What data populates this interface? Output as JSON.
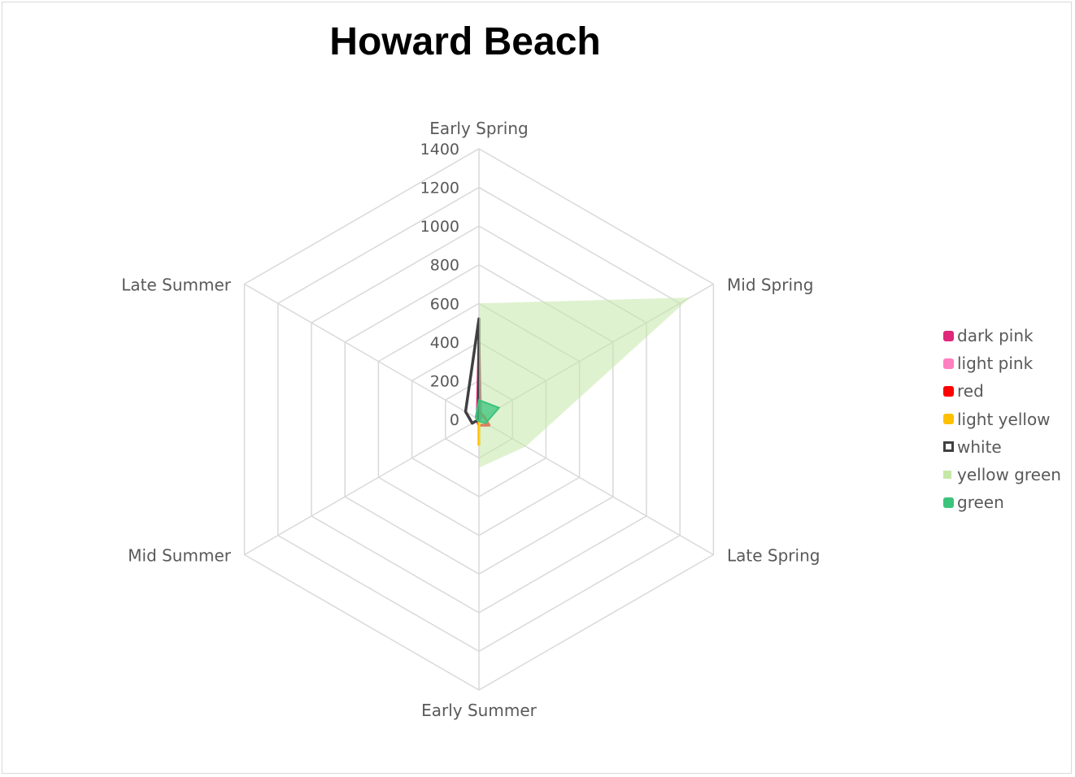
{
  "chart_data": {
    "type": "radar",
    "title": "Howard Beach",
    "axes": [
      "Early Spring",
      "Mid Spring",
      "Late Spring",
      "Early Summer",
      "Mid Summer",
      "Late Summer"
    ],
    "ticks": [
      "0",
      "200",
      "400",
      "600",
      "800",
      "1000",
      "1200",
      "1400"
    ],
    "rlim": [
      0,
      1400
    ],
    "grid": true,
    "legend_position": "right",
    "series": [
      {
        "name": "dark pink",
        "values": [
          390,
          10,
          0,
          0,
          0,
          10
        ],
        "color": "#e0287a",
        "style": "line"
      },
      {
        "name": "light pink",
        "values": [
          0,
          0,
          0,
          0,
          0,
          0
        ],
        "color": "#ff80c0",
        "style": "line"
      },
      {
        "name": "red",
        "values": [
          40,
          30,
          60,
          30,
          10,
          0
        ],
        "color": "#ff0000",
        "style": "line"
      },
      {
        "name": "light yellow",
        "values": [
          0,
          0,
          0,
          130,
          0,
          0
        ],
        "color": "#ffc000",
        "style": "line"
      },
      {
        "name": "white",
        "values": [
          520,
          0,
          0,
          0,
          40,
          80
        ],
        "color": "#404040",
        "style": "line"
      },
      {
        "name": "yellow green",
        "values": [
          600,
          1260,
          280,
          250,
          0,
          0
        ],
        "color": "#c5e8a7",
        "style": "area"
      },
      {
        "name": "green",
        "values": [
          100,
          120,
          40,
          10,
          10,
          20
        ],
        "color": "#3cc47c",
        "style": "area"
      }
    ]
  }
}
